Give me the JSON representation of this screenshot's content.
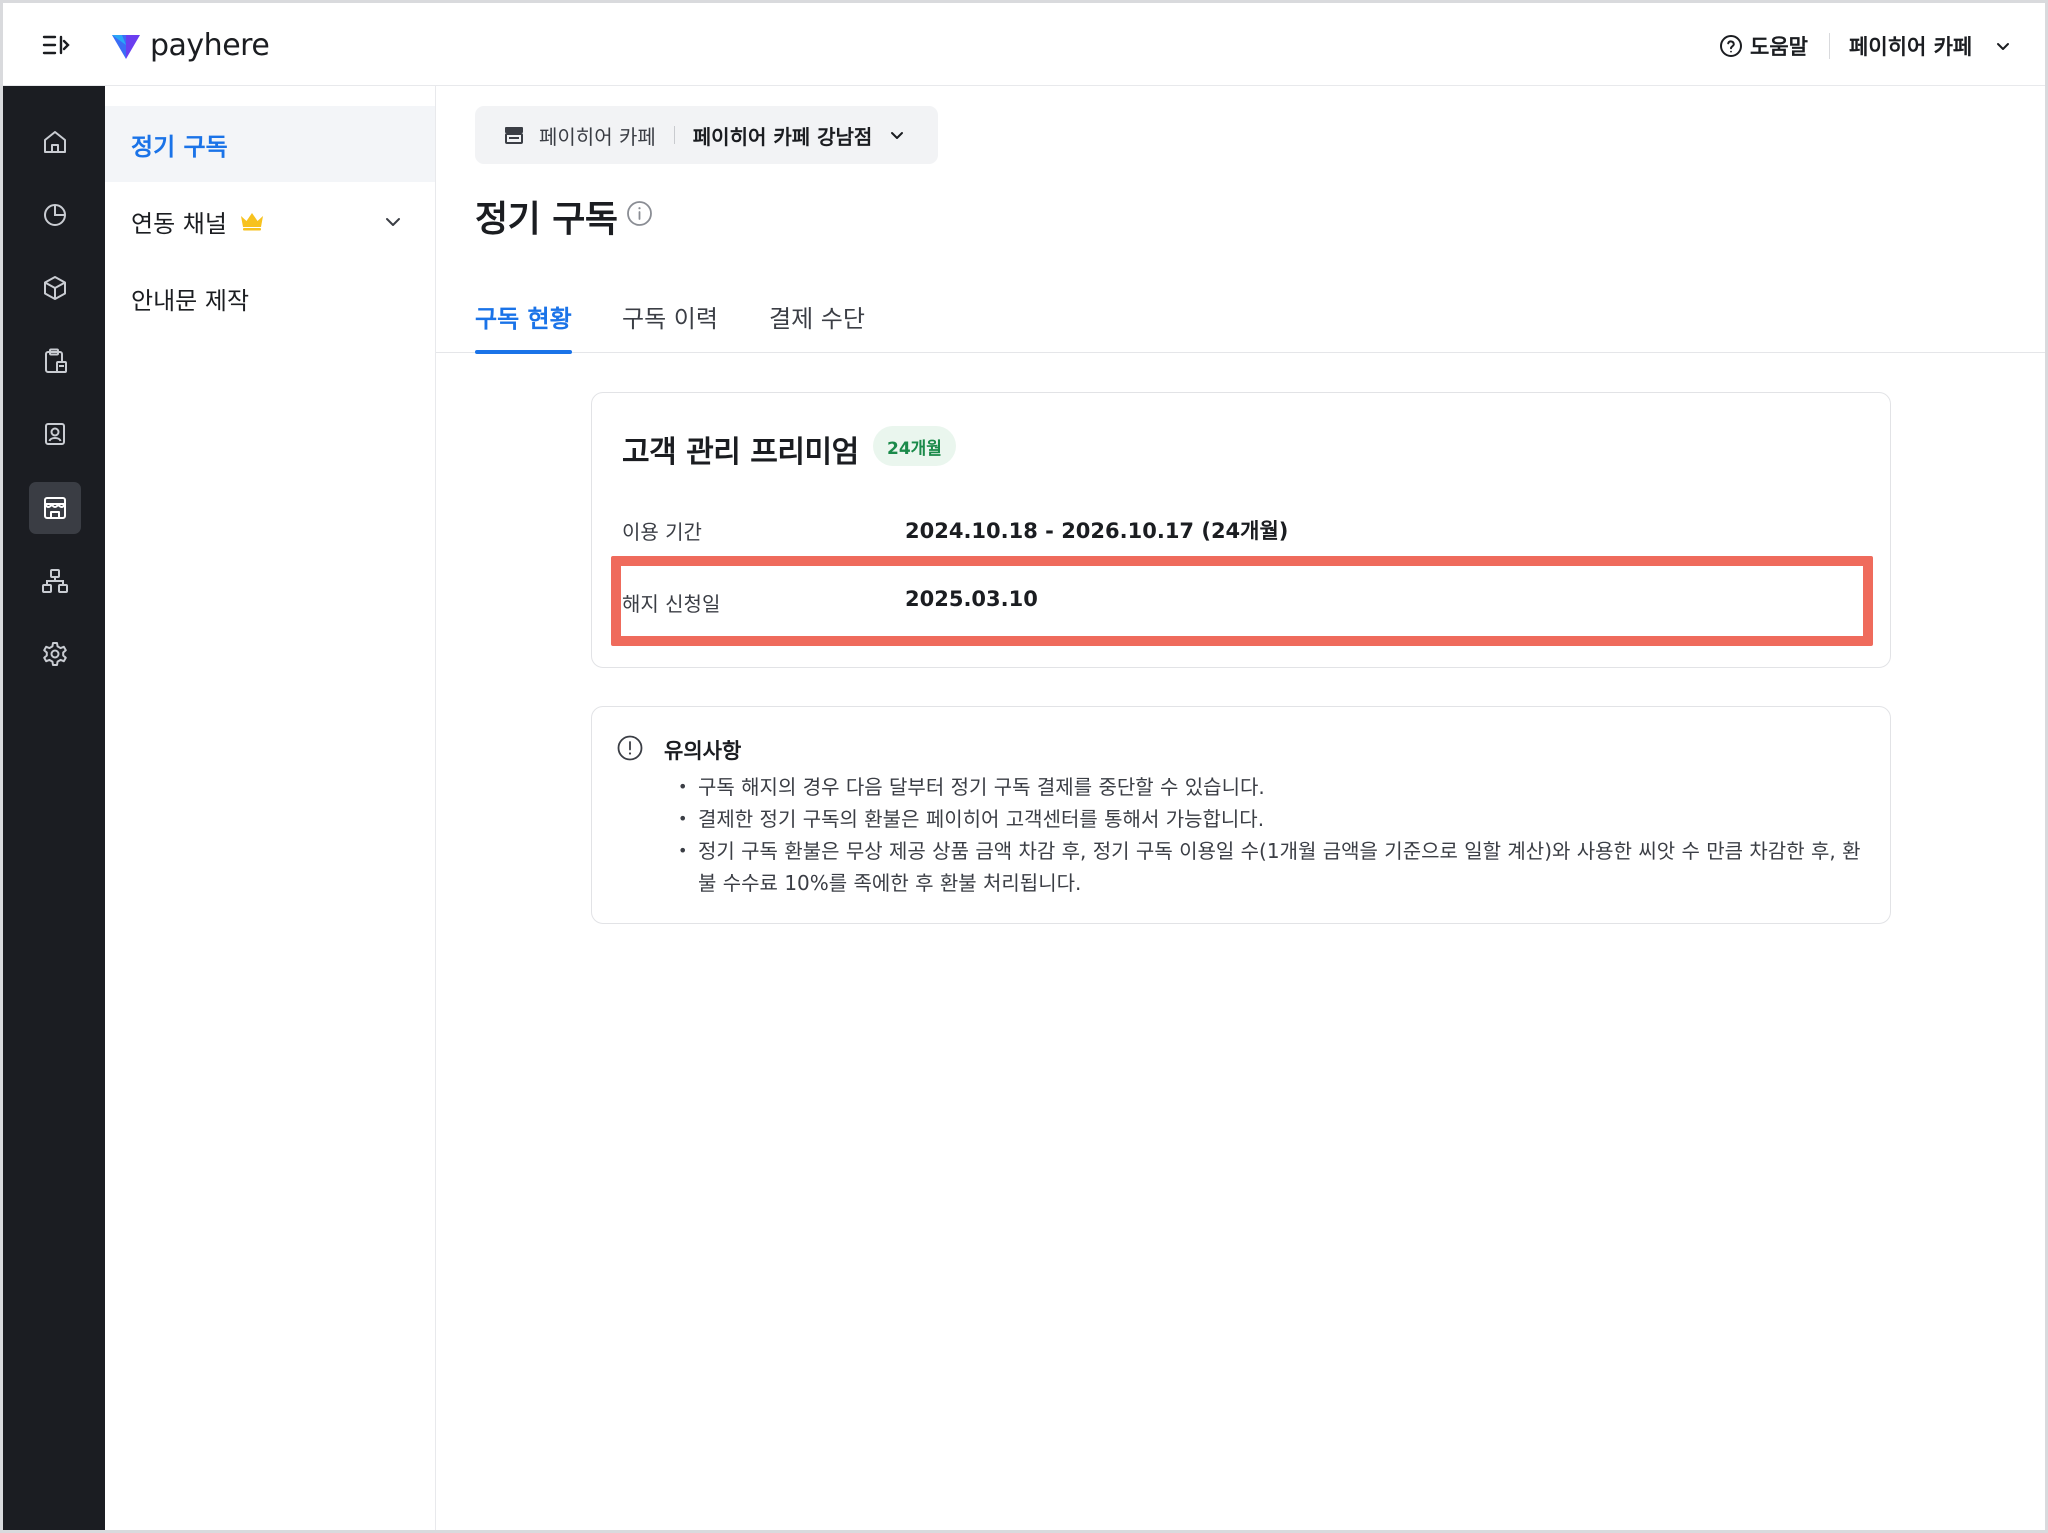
{
  "header": {
    "logo_text": "payhere",
    "help_label": "도움말",
    "store_menu_label": "페이히어 카페"
  },
  "sidebar": {
    "items": [
      {
        "icon": "home-icon"
      },
      {
        "icon": "pie-chart-icon"
      },
      {
        "icon": "box-icon"
      },
      {
        "icon": "clipboard-icon"
      },
      {
        "icon": "contact-card-icon"
      },
      {
        "icon": "store-icon",
        "active": true
      },
      {
        "icon": "org-chart-icon"
      },
      {
        "icon": "gear-icon"
      }
    ]
  },
  "subnav": {
    "items": [
      {
        "label": "정기 구독",
        "active": true
      },
      {
        "label": "연동 채널",
        "premium": true,
        "expandable": true
      },
      {
        "label": "안내문 제작"
      }
    ]
  },
  "store_selector": {
    "brand": "페이히어 카페",
    "branch": "페이히어 카페 강남점"
  },
  "page": {
    "title": "정기 구독"
  },
  "tabs": [
    {
      "label": "구독 현황",
      "active": true
    },
    {
      "label": "구독 이력"
    },
    {
      "label": "결제 수단"
    }
  ],
  "subscription": {
    "plan_name": "고객 관리 프리미엄",
    "badge": "24개월",
    "period_label": "이용 기간",
    "period_value": "2024.10.18 - 2026.10.17 (24개월)",
    "cancel_label": "해지 신청일",
    "cancel_value": "2025.03.10"
  },
  "notice": {
    "title": "유의사항",
    "items": [
      "구독 해지의 경우 다음 달부터 정기 구독 결제를 중단할 수 있습니다.",
      "결제한 정기 구독의 환불은 페이히어 고객센터를 통해서 가능합니다.",
      "정기 구독 환불은 무상 제공 상품 금액 차감 후, 정기 구독 이용일 수(1개월 금액을 기준으로 일할 계산)와 사용한 씨앗 수 만큼 차감한 후, 환불 수수료 10%를 족에한 후 환불 처리됩니다."
    ]
  },
  "colors": {
    "accent": "#1a73e8",
    "rail": "#1b1d22",
    "highlight": "#ef6b5c",
    "badge_bg": "#eaf6ee",
    "badge_text": "#1a8a4a"
  }
}
